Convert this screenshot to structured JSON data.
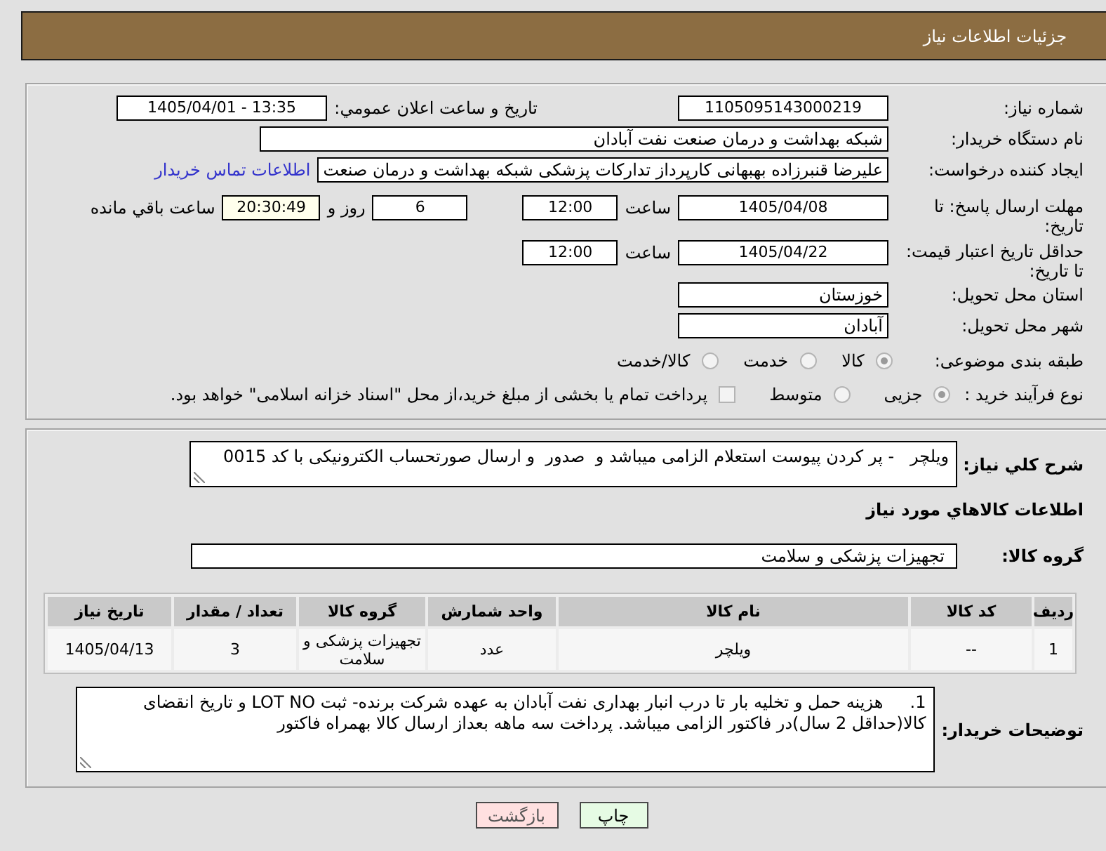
{
  "header": {
    "title": "جزئیات اطلاعات نیاز"
  },
  "details": {
    "need_number": {
      "label": "شماره نیاز:",
      "value": "1105095143000219"
    },
    "announce": {
      "label": "تاریخ و ساعت اعلان عمومي:",
      "value": "1405/04/01 - 13:35"
    },
    "buyer_org": {
      "label": "نام دستگاه خریدار:",
      "value": "شبکه بهداشت و درمان صنعت نفت آبادان"
    },
    "requester": {
      "label": "ایجاد کننده درخواست:",
      "value": "علیرضا قنبرزاده بهبهانی کارپرداز تدارکات پزشکی شبکه بهداشت و درمان صنعت",
      "link": "اطلاعات تماس خریدار"
    },
    "reply_deadline": {
      "label": "مهلت ارسال پاسخ: تا تاریخ:",
      "date": "1405/04/08",
      "time_label": "ساعت",
      "time": "12:00",
      "days": "6",
      "days_label": "روز و",
      "remaining": "20:30:49",
      "remaining_label": "ساعت باقي مانده"
    },
    "price_validity": {
      "label": "حداقل تاریخ اعتبار قیمت: تا تاریخ:",
      "date": "1405/04/22",
      "time_label": "ساعت",
      "time": "12:00"
    },
    "province": {
      "label": "استان محل تحویل:",
      "value": "خوزستان"
    },
    "city": {
      "label": "شهر محل تحویل:",
      "value": "آبادان"
    },
    "category": {
      "label": "طبقه بندی موضوعی:",
      "options": [
        {
          "label": "کالا",
          "selected": true
        },
        {
          "label": "خدمت",
          "selected": false
        },
        {
          "label": "کالا/خدمت",
          "selected": false
        }
      ]
    },
    "purchase_type": {
      "label": "نوع فرآیند خرید :",
      "options": [
        {
          "label": "جزیی",
          "selected": true
        },
        {
          "label": "متوسط",
          "selected": false
        }
      ],
      "treasury": {
        "label": "پرداخت تمام یا بخشی از مبلغ خرید،از محل \"اسناد خزانه اسلامی\" خواهد بود.",
        "checked": false
      }
    }
  },
  "description": {
    "label": "شرح کلي نیاز:",
    "value": "ویلچر   - پر کردن پیوست استعلام الزامی میباشد و  صدور  و ارسال صورتحساب الکترونیکی با کد 0015"
  },
  "goods": {
    "title": "اطلاعات کالاهاي مورد نیاز",
    "group": {
      "label": "گروه کالا:",
      "value": "تجهیزات پزشکی و سلامت"
    },
    "table": {
      "columns": [
        "ردیف",
        "کد کالا",
        "نام کالا",
        "واحد شمارش",
        "گروه کالا",
        "تعداد / مقدار",
        "تاریخ نیاز"
      ],
      "rows": [
        [
          "1",
          "--",
          "ویلچر",
          "عدد",
          "تجهیزات پزشکی و سلامت",
          "3",
          "1405/04/13"
        ]
      ]
    }
  },
  "buyer_notes": {
    "label": "توضیحات خریدار:",
    "value": "1.     هزینه حمل و تخلیه بار تا درب انبار بهداری نفت آبادان به عهده شرکت برنده- ثبت LOT NO و تاریخ انقضای کالا(حداقل 2 سال)در فاکتور الزامی میباشد. پرداخت سه ماهه بعداز ارسال کالا بهمراه فاکتور"
  },
  "buttons": [
    {
      "kind": "print",
      "label": "چاپ"
    },
    {
      "kind": "back",
      "label": "بازگشت"
    }
  ]
}
